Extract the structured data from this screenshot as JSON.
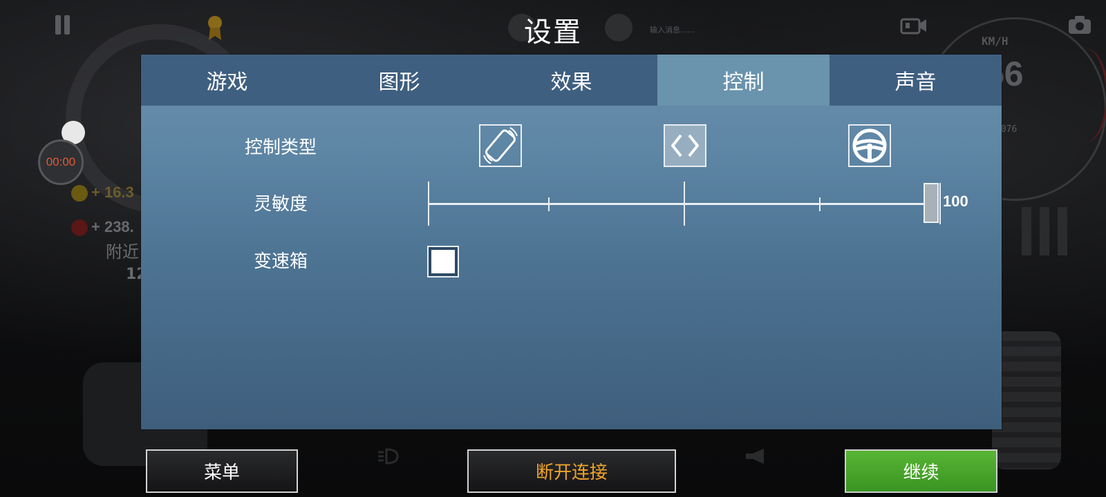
{
  "header": {
    "title": "设置",
    "timer": "00:00",
    "chat_hint": "输入消息......"
  },
  "hud_background": {
    "speed_unit": "KM/H",
    "speed_value": "56",
    "odometer": "0076",
    "coins": "+ 16.3",
    "gems": "+ 238.",
    "nearby_label": "附近",
    "nearby_count": "12"
  },
  "tabs": [
    {
      "label": "游戏",
      "active": false
    },
    {
      "label": "图形",
      "active": false
    },
    {
      "label": "效果",
      "active": false
    },
    {
      "label": "控制",
      "active": true
    },
    {
      "label": "声音",
      "active": false
    }
  ],
  "control_settings": {
    "control_type": {
      "label": "控制类型",
      "options": [
        {
          "icon": "phone-tilt-icon",
          "selected": false
        },
        {
          "icon": "arrows-icon",
          "selected": true
        },
        {
          "icon": "steering-wheel-icon",
          "selected": false
        }
      ]
    },
    "sensitivity": {
      "label": "灵敏度",
      "value": "100",
      "fraction": 1.0
    },
    "gearbox": {
      "label": "变速箱",
      "checked": false
    }
  },
  "buttons": {
    "menu": "菜单",
    "disconnect": "断开连接",
    "continue": "继续"
  },
  "colors": {
    "accent_orange": "#f0a52a",
    "continue_green": "#4aa52b",
    "tab_bar": "#3f5f80",
    "tab_active": "#6a93ae",
    "timer_red": "#e05a3a"
  }
}
